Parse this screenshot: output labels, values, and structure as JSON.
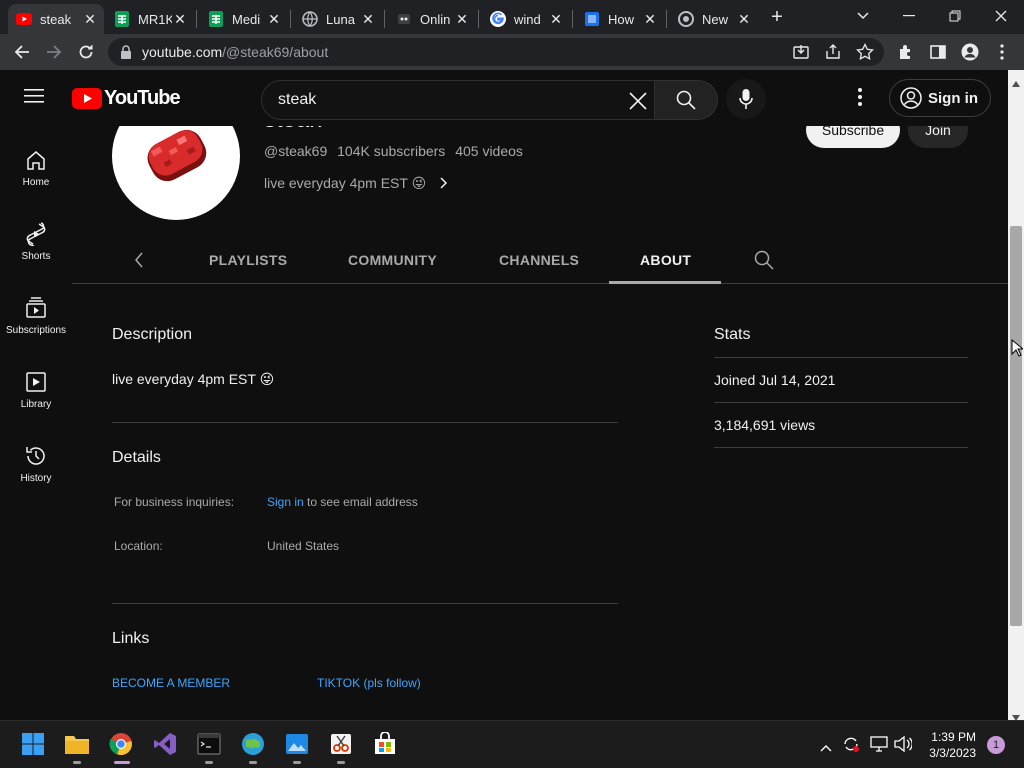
{
  "browser": {
    "tabs": [
      {
        "title": "steak",
        "icon": "youtube-icon",
        "active": true
      },
      {
        "title": "MR1K",
        "icon": "sheets-icon"
      },
      {
        "title": "Medi",
        "icon": "sheets-icon"
      },
      {
        "title": "Luna",
        "icon": "globe-icon"
      },
      {
        "title": "Onlin",
        "icon": "site-icon"
      },
      {
        "title": "wind",
        "icon": "google-icon"
      },
      {
        "title": "How",
        "icon": "bookmark-icon"
      },
      {
        "title": "New",
        "icon": "chrome-icon"
      }
    ],
    "new_tab_symbol": "+",
    "url_host": "youtube.com",
    "url_path": "/@steak69/about"
  },
  "youtube": {
    "logo_text": "YouTube",
    "search_value": "steak",
    "signin_label": "Sign in",
    "guide": [
      {
        "label": "Home",
        "icon": "home-icon"
      },
      {
        "label": "Shorts",
        "icon": "shorts-icon"
      },
      {
        "label": "Subscriptions",
        "icon": "subscriptions-icon"
      },
      {
        "label": "Library",
        "icon": "library-icon"
      },
      {
        "label": "History",
        "icon": "history-icon"
      }
    ],
    "channel": {
      "name": "steak",
      "handle": "@steak69",
      "subscribers": "104K subscribers",
      "videos": "405 videos",
      "tagline": "live everyday 4pm EST 😜",
      "subscribe_label": "Subscribe",
      "join_label": "Join"
    },
    "tabs": [
      "PLAYLISTS",
      "COMMUNITY",
      "CHANNELS",
      "ABOUT"
    ],
    "selected_tab": "ABOUT",
    "about": {
      "description_heading": "Description",
      "description_text": "live everyday 4pm EST 😜",
      "details_heading": "Details",
      "business_label": "For business inquiries:",
      "business_link": "Sign in",
      "business_suffix": "to see email address",
      "location_label": "Location:",
      "location_value": "United States",
      "links_heading": "Links",
      "links": [
        "BECOME A MEMBER",
        "TIKTOK (pls follow)"
      ],
      "stats_heading": "Stats",
      "joined": "Joined Jul 14, 2021",
      "views": "3,184,691 views"
    }
  },
  "taskbar": {
    "time": "1:39 PM",
    "date": "3/3/2023",
    "notification_count": "1",
    "apps": [
      "start-icon",
      "file-explorer-icon",
      "chrome-icon",
      "visual-studio-icon",
      "terminal-icon",
      "maps-icon",
      "photos-icon",
      "snipping-tool-icon",
      "store-icon"
    ]
  },
  "colors": {
    "youtube_red": "#ff0000",
    "link_blue": "#3ea6ff",
    "bg": "#0f0f0f"
  }
}
